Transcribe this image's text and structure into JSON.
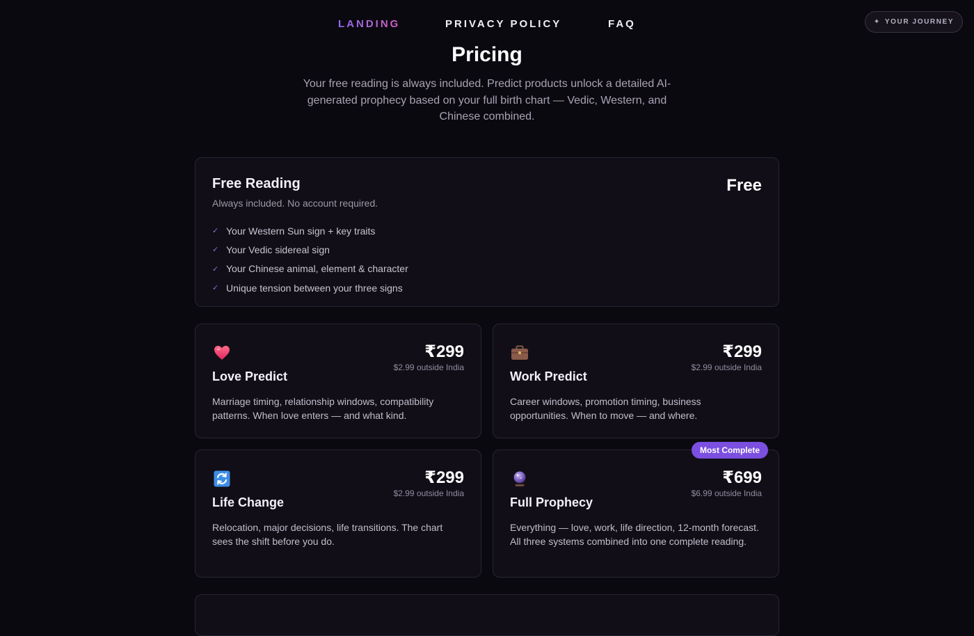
{
  "nav": {
    "items": [
      {
        "label": "LANDING"
      },
      {
        "label": "PRIVACY POLICY"
      },
      {
        "label": "FAQ"
      }
    ],
    "journey_label": "YOUR JOURNEY",
    "journey_icon": "sparkle-icon"
  },
  "header": {
    "title": "Pricing",
    "subtitle": "Your free reading is always included. Predict products unlock a detailed AI-generated prophecy based on your full birth chart — Vedic, Western, and Chinese combined."
  },
  "free": {
    "name": "Free Reading",
    "desc": "Always included. No account required.",
    "price": "Free",
    "features": [
      "Your Western Sun sign + key traits",
      "Your Vedic sidereal sign",
      "Your Chinese animal, element & character",
      "Unique tension between your three signs"
    ]
  },
  "products": [
    {
      "name": "Love Predict",
      "icon": "heart-icon",
      "price": "₹299",
      "intl": "$2.99 outside India",
      "desc": "Marriage timing, relationship windows, compatibility patterns. When love enters — and what kind."
    },
    {
      "name": "Work Predict",
      "icon": "briefcase-icon",
      "price": "₹299",
      "intl": "$2.99 outside India",
      "desc": "Career windows, promotion timing, business opportunities. When to move — and where."
    },
    {
      "name": "Life Change",
      "icon": "cycle-arrows-icon",
      "price": "₹299",
      "intl": "$2.99 outside India",
      "desc": "Relocation, major decisions, life transitions. The chart sees the shift before you do."
    },
    {
      "name": "Full Prophecy",
      "icon": "crystal-ball-icon",
      "price": "₹699",
      "intl": "$6.99 outside India",
      "desc": "Everything — love, work, life direction, 12-month forecast. All three systems combined into one complete reading.",
      "badge": "Most Complete"
    }
  ],
  "colors": {
    "background": "#0b0910",
    "card": "#110e17",
    "accent": "#7b4fe0"
  }
}
